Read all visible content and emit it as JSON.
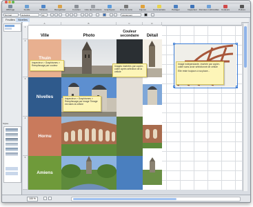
{
  "toolbar": {
    "items": [
      {
        "label": "Affichage",
        "icon": "view-icon",
        "color": "#7a8c9e"
      },
      {
        "label": "Feuille",
        "icon": "sheet-icon",
        "color": "#6a9fd4"
      },
      {
        "label": "Tableaux",
        "icon": "table-icon",
        "color": "#4e86c9"
      },
      {
        "label": "Réorganiser",
        "icon": "reorganize-icon",
        "color": "#d9a24a"
      },
      {
        "label": "Fonction",
        "icon": "function-icon",
        "color": "#8a8f96"
      },
      {
        "label": "Liste des fonctions",
        "icon": "function-list-icon",
        "color": "#9b9fa5"
      },
      {
        "label": "Graphiques",
        "icon": "chart-icon",
        "color": "#5d9cdc"
      },
      {
        "label": "Zone de texte",
        "icon": "textbox-icon",
        "color": "#777"
      },
      {
        "label": "Figures",
        "icon": "shapes-icon",
        "color": "#e0a23b"
      },
      {
        "label": "Commentaire",
        "icon": "comment-icon",
        "color": "#e8d44d"
      },
      {
        "label": "Partager",
        "icon": "share-icon",
        "color": "#4a7fc1"
      },
      {
        "label": "Inspecteur",
        "icon": "inspector-icon",
        "color": "#3e73b8"
      },
      {
        "label": "Données multimédias",
        "icon": "media-icon",
        "color": "#6fa1d8"
      },
      {
        "label": "Couleurs",
        "icon": "colors-icon",
        "color": "#d04a4a"
      },
      {
        "label": "Polices",
        "icon": "fonts-icon",
        "color": "#555"
      }
    ]
  },
  "formatbar": {
    "style_value": "Normal",
    "font_value": "Helvetica",
    "size_value": "10",
    "extra_value": "Ajustement"
  },
  "sheets": {
    "header": "Feuilles",
    "sheet_label": "Nivelles"
  },
  "sidebar": {
    "styles_header": "Styles"
  },
  "table": {
    "headers": [
      "Ville",
      "Photo",
      "Couleur secondaire",
      "Détail"
    ],
    "rows": [
      {
        "city": "Thuin",
        "color": "#e8b090",
        "accent": "#2a2f33"
      },
      {
        "city": "Nivelles",
        "color": "#2f5a8c",
        "accent": "#e4dfd7"
      },
      {
        "city": "Hornu",
        "color": "#c97a5c",
        "accent": "#5a7a3a"
      },
      {
        "city": "Amiens",
        "color": "#6f9a3a",
        "accent": "#4a7fbf"
      }
    ]
  },
  "notes": {
    "n1": "Inspecteur > Graphismes > Remplissage par couleur",
    "n2": "Images insérées par copier-coller après sélection de la cellule",
    "n3": "Inspecteur > Graphismes > Remplissage par image Timage est dans la cellule",
    "n4": "Image indépendante, insérée par copier-coller sans avoir sélectionné de cellule",
    "n5": "Elle reste toujours à sa place..."
  },
  "status": {
    "zoom": "100 %"
  }
}
